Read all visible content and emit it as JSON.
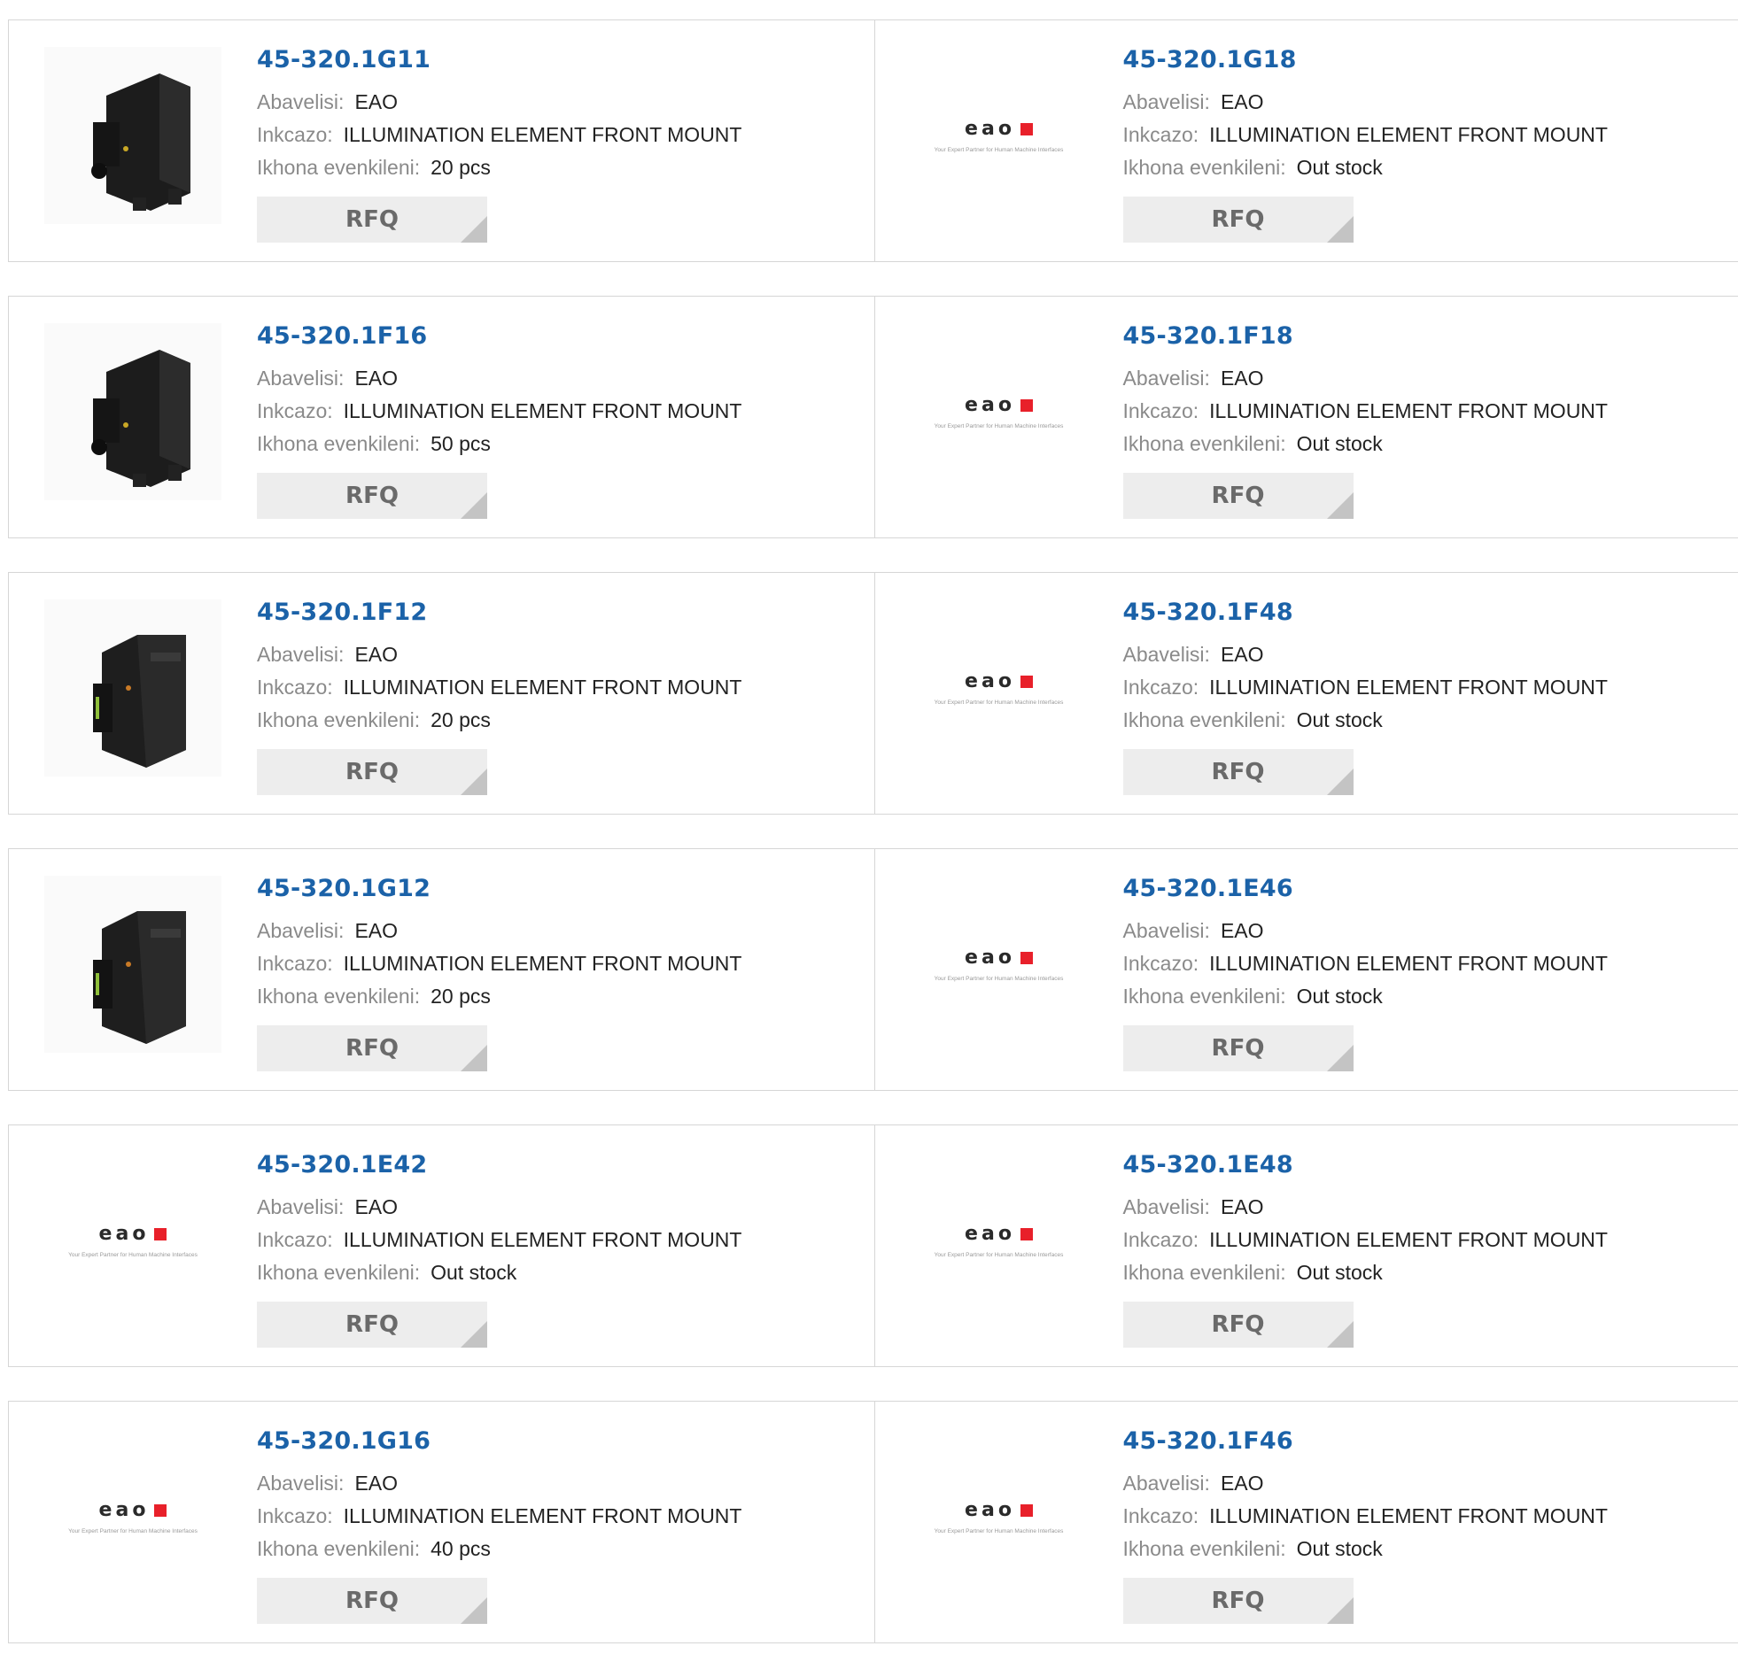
{
  "labels": {
    "manufacturer": "Abavelisi:",
    "description": "Inkcazo:",
    "stock": "Ikhona evenkileni:",
    "rfq": "RFQ"
  },
  "logo": {
    "text": "eao",
    "tagline": "Your Expert Partner for Human Machine Interfaces",
    "accent_color": "#e8202a"
  },
  "colors": {
    "part_number": "#1b62a8"
  },
  "products": [
    {
      "part_number": "45-320.1G11",
      "manufacturer": "EAO",
      "description": "ILLUMINATION ELEMENT FRONT MOUNT",
      "stock": "20 pcs",
      "image": "module-photo",
      "variant": "a"
    },
    {
      "part_number": "45-320.1G18",
      "manufacturer": "EAO",
      "description": "ILLUMINATION ELEMENT FRONT MOUNT",
      "stock": "Out stock",
      "image": "eao-logo"
    },
    {
      "part_number": "45-320.1F16",
      "manufacturer": "EAO",
      "description": "ILLUMINATION ELEMENT FRONT MOUNT",
      "stock": "50 pcs",
      "image": "module-photo",
      "variant": "a"
    },
    {
      "part_number": "45-320.1F18",
      "manufacturer": "EAO",
      "description": "ILLUMINATION ELEMENT FRONT MOUNT",
      "stock": "Out stock",
      "image": "eao-logo"
    },
    {
      "part_number": "45-320.1F12",
      "manufacturer": "EAO",
      "description": "ILLUMINATION ELEMENT FRONT MOUNT",
      "stock": "20 pcs",
      "image": "module-photo",
      "variant": "b"
    },
    {
      "part_number": "45-320.1F48",
      "manufacturer": "EAO",
      "description": "ILLUMINATION ELEMENT FRONT MOUNT",
      "stock": "Out stock",
      "image": "eao-logo"
    },
    {
      "part_number": "45-320.1G12",
      "manufacturer": "EAO",
      "description": "ILLUMINATION ELEMENT FRONT MOUNT",
      "stock": "20 pcs",
      "image": "module-photo",
      "variant": "b"
    },
    {
      "part_number": "45-320.1E46",
      "manufacturer": "EAO",
      "description": "ILLUMINATION ELEMENT FRONT MOUNT",
      "stock": "Out stock",
      "image": "eao-logo"
    },
    {
      "part_number": "45-320.1E42",
      "manufacturer": "EAO",
      "description": "ILLUMINATION ELEMENT FRONT MOUNT",
      "stock": "Out stock",
      "image": "eao-logo"
    },
    {
      "part_number": "45-320.1E48",
      "manufacturer": "EAO",
      "description": "ILLUMINATION ELEMENT FRONT MOUNT",
      "stock": "Out stock",
      "image": "eao-logo"
    },
    {
      "part_number": "45-320.1G16",
      "manufacturer": "EAO",
      "description": "ILLUMINATION ELEMENT FRONT MOUNT",
      "stock": "40 pcs",
      "image": "eao-logo"
    },
    {
      "part_number": "45-320.1F46",
      "manufacturer": "EAO",
      "description": "ILLUMINATION ELEMENT FRONT MOUNT",
      "stock": "Out stock",
      "image": "eao-logo"
    }
  ]
}
